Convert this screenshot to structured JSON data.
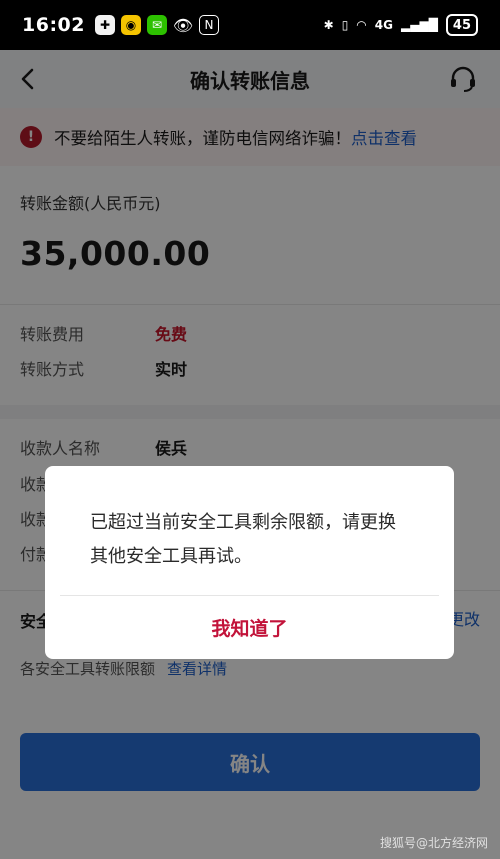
{
  "status_bar": {
    "time": "16:02",
    "network": "4G",
    "battery": "45"
  },
  "header": {
    "title": "确认转账信息"
  },
  "warning": {
    "text": "不要给陌生人转账，谨防电信网络诈骗！",
    "link": "点击查看"
  },
  "amount": {
    "label": "转账金额(人民币元)",
    "value": "35,000.00"
  },
  "fee": {
    "label": "转账费用",
    "value": "免费"
  },
  "method": {
    "label": "转账方式",
    "value": "实时"
  },
  "payee": {
    "label": "收款人名称",
    "value": "侯兵"
  },
  "payee_account": {
    "label": "收款"
  },
  "payee_bank": {
    "label": "收款"
  },
  "payer_account": {
    "label": "付款"
  },
  "security_tool": {
    "label": "安全",
    "change_link": "更改"
  },
  "limits": {
    "label": "各安全工具转账限额",
    "link": "查看详情"
  },
  "confirm_button": "确认",
  "dialog": {
    "message": "已超过当前安全工具剩余限额，请更换其他安全工具再试。",
    "ok_button": "我知道了"
  },
  "watermark": "搜狐号@北方经济网",
  "colors": {
    "accent_blue": "#1d5fc9",
    "alert_red": "#c2133a",
    "confirm_button": "#2a6fd9"
  }
}
